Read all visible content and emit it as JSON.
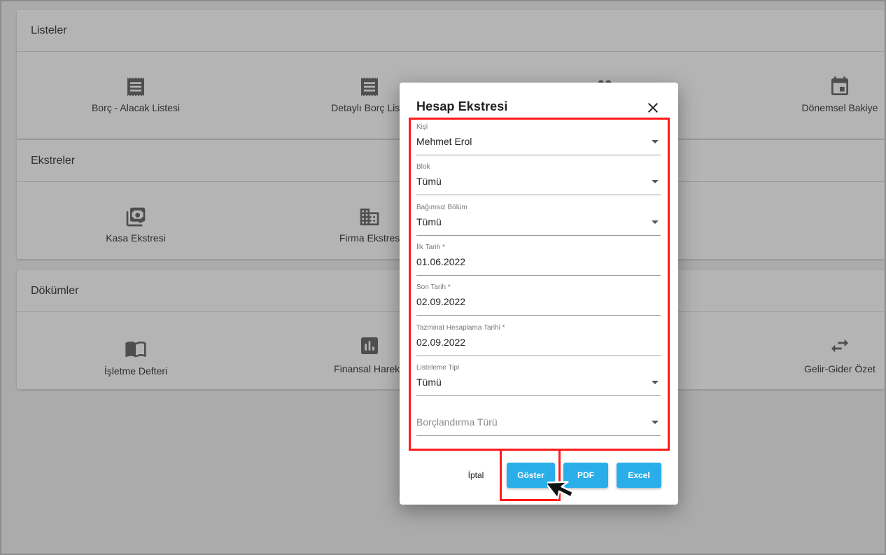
{
  "sections": {
    "listeler": {
      "title": "Listeler",
      "tiles": [
        {
          "label": "Borç - Alacak Listesi",
          "icon": "receipt-icon"
        },
        {
          "label": "Detaylı Borç Liste",
          "icon": "receipt-icon"
        },
        {
          "label": "",
          "icon": "people-icon"
        },
        {
          "label": "Dönemsel Bakiye",
          "icon": "calendar-icon"
        }
      ]
    },
    "ekstreler": {
      "title": "Ekstreler",
      "tiles": [
        {
          "label": "Kasa Ekstresi",
          "icon": "cash-icon"
        },
        {
          "label": "Firma Ekstres",
          "icon": "building-icon"
        }
      ]
    },
    "dokumler": {
      "title": "Dökümler",
      "tiles": [
        {
          "label": "İşletme Defteri",
          "icon": "book-icon"
        },
        {
          "label": "Finansal Hareke",
          "icon": "bar-chart-icon"
        },
        {
          "label": "Gelir-Gider Özet",
          "icon": "swap-icon"
        }
      ]
    }
  },
  "dialog": {
    "title": "Hesap Ekstresi",
    "close_icon": "close-icon",
    "fields": {
      "kisi": {
        "label": "Kişi",
        "value": "Mehmet Erol"
      },
      "blok": {
        "label": "Blok",
        "value": "Tümü"
      },
      "bolum": {
        "label": "Bağımsız Bölüm",
        "value": "Tümü"
      },
      "ilk_tarih": {
        "label": "İlk Tarih *",
        "value": "01.06.2022"
      },
      "son_tarih": {
        "label": "Son Tarih *",
        "value": "02.09.2022"
      },
      "tazminat": {
        "label": "Tazminat Hesaplama Tarihi *",
        "value": "02.09.2022"
      },
      "listeleme": {
        "label": "Listeleme Tipi",
        "value": "Tümü"
      },
      "borclandirma": {
        "placeholder": "Borçlandırma Türü"
      }
    },
    "buttons": {
      "cancel": "İptal",
      "show": "Göster",
      "pdf": "PDF",
      "excel": "Excel"
    }
  },
  "colors": {
    "accent": "#2aaee9",
    "highlight": "#ff1a1a",
    "overlay": "#ababab"
  }
}
